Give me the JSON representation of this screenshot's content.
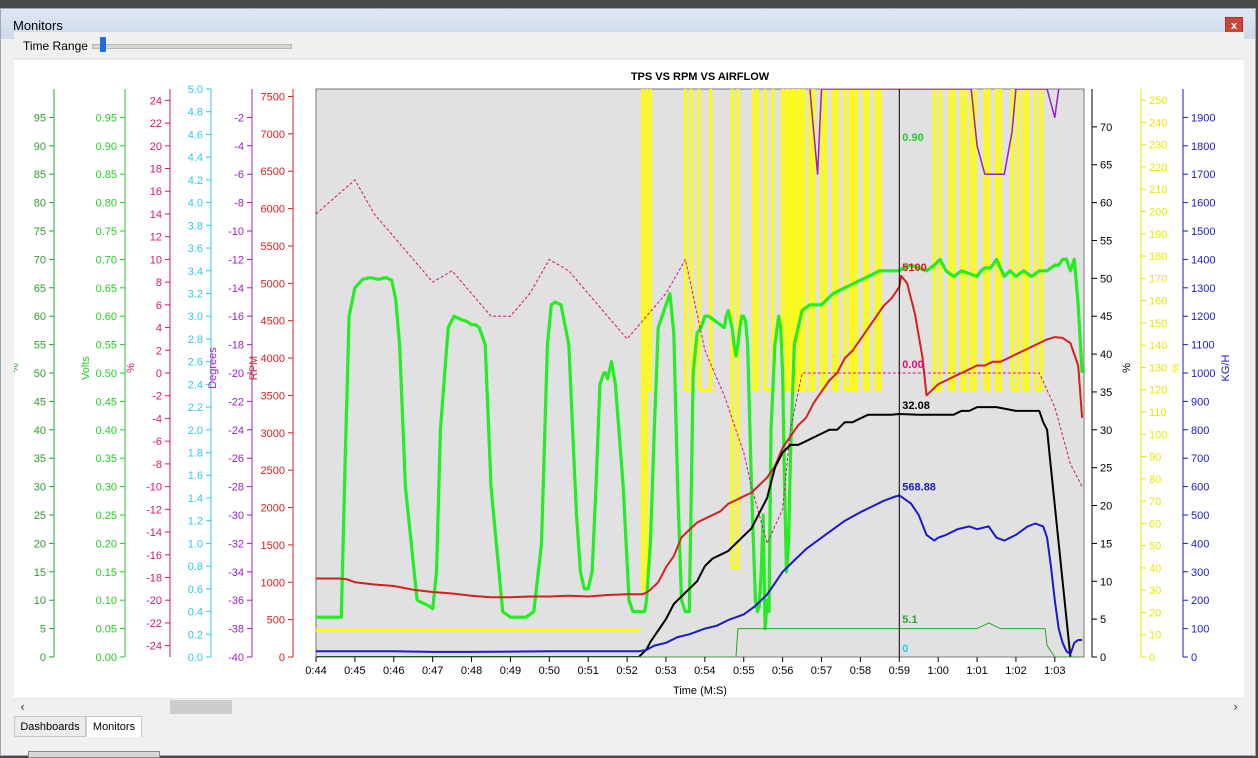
{
  "window": {
    "title": "Monitors",
    "close_label": "x"
  },
  "toolbar": {
    "time_range_label": "Time Range",
    "time_range_position": 0.06
  },
  "tabs": [
    "Dashboards",
    "Monitors"
  ],
  "scroll": {
    "left_arrow": "‹",
    "right_arrow": "›"
  },
  "chart_data": {
    "type": "line",
    "title": "TPS VS RPM VS AIRFLOW",
    "xlabel": "Time (M:S)",
    "x_ticks": [
      "0:44",
      "0:45",
      "0:46",
      "0:47",
      "0:48",
      "0:49",
      "0:50",
      "0:51",
      "0:52",
      "0:53",
      "0:54",
      "0:55",
      "0:56",
      "0:57",
      "0:58",
      "0:59",
      "1:00",
      "1:01",
      "1:02",
      "1:03"
    ],
    "xlim": [
      44,
      63.75
    ],
    "cursor_x": 59,
    "axes": [
      {
        "id": "pct_left",
        "label": "%",
        "color": "#2e9c2e",
        "side": "left",
        "min": 0,
        "max": 100,
        "tick_min": 0,
        "tick_max": 95,
        "step": 5,
        "decimals": 0
      },
      {
        "id": "volts",
        "label": "Volts",
        "color": "#22cc22",
        "side": "left",
        "min": 0,
        "max": 1,
        "tick_min": 0,
        "tick_max": 0.95,
        "step": 0.05,
        "decimals": 2
      },
      {
        "id": "pct_pink",
        "label": "%",
        "color": "#d4147a",
        "side": "left",
        "min": -25,
        "max": 25,
        "tick_min": -24,
        "tick_max": 24,
        "step": 2,
        "decimals": 0
      },
      {
        "id": "fivev",
        "label": "",
        "color": "#2cc8ec",
        "side": "left",
        "min": 0,
        "max": 5,
        "tick_min": 0,
        "tick_max": 5,
        "step": 0.2,
        "decimals": 1
      },
      {
        "id": "degrees",
        "label": "Degrees",
        "color": "#9a1fc8",
        "side": "left",
        "min": -40,
        "max": 0,
        "tick_min": -40,
        "tick_max": -2,
        "step": 2,
        "decimals": 0
      },
      {
        "id": "rpm",
        "label": "RPM",
        "color": "#d42020",
        "side": "left",
        "min": 0,
        "max": 7600,
        "tick_min": 0,
        "tick_max": 7500,
        "step": 500,
        "decimals": 0
      },
      {
        "id": "pct_right",
        "label": "%",
        "color": "#000000",
        "side": "right",
        "min": 0,
        "max": 75,
        "tick_min": 0,
        "tick_max": 70,
        "step": 5,
        "decimals": 0
      },
      {
        "id": "pct_yellow",
        "label": "%",
        "color": "#e8e800",
        "side": "right",
        "min": 0,
        "max": 255,
        "tick_min": 0,
        "tick_max": 250,
        "step": 10,
        "decimals": 0
      },
      {
        "id": "kgh",
        "label": "KG/H",
        "color": "#1a1ac8",
        "side": "right",
        "min": 0,
        "max": 2000,
        "tick_min": 0,
        "tick_max": 1900,
        "step": 100,
        "decimals": 0
      }
    ],
    "series": [
      {
        "axis": "pct_left",
        "color": "#22ee22",
        "width": 3.2,
        "dash": "",
        "x": [
          44,
          44.6,
          44.65,
          44.75,
          44.85,
          45,
          45.2,
          45.4,
          45.6,
          45.8,
          45.95,
          46.05,
          46.15,
          46.3,
          46.6,
          46.9,
          47.0,
          47.1,
          47.2,
          47.4,
          47.55,
          47.7,
          47.9,
          48.0,
          48.1,
          48.2,
          48.35,
          48.5,
          48.8,
          49.0,
          49.2,
          49.4,
          49.6,
          49.8,
          49.95,
          50.05,
          50.15,
          50.3,
          50.5,
          50.6,
          50.7,
          50.8,
          50.9,
          51.0,
          51.1,
          51.2,
          51.3,
          51.4,
          51.45,
          51.5,
          51.6,
          51.7,
          51.9,
          52.05,
          52.15,
          52.25,
          52.35,
          52.4,
          52.45,
          52.5,
          52.6,
          52.7,
          52.8,
          52.9,
          53.0,
          53.1,
          53.2,
          53.3,
          53.4,
          53.5,
          53.6,
          53.7,
          53.8,
          53.9,
          54.0,
          54.1,
          54.3,
          54.5,
          54.55,
          54.6,
          54.7,
          54.75,
          54.8,
          54.85,
          54.9,
          54.95,
          55.0,
          55.05,
          55.1,
          55.2,
          55.3,
          55.35,
          55.4,
          55.45,
          55.5,
          55.55,
          55.6,
          55.65,
          55.7,
          55.8,
          55.9,
          55.95,
          56.0,
          56.05,
          56.1,
          56.15,
          56.2,
          56.3,
          56.5,
          56.7,
          56.8,
          57.0,
          57.3,
          57.6,
          57.9,
          58.2,
          58.5,
          58.8,
          59.0,
          59.1,
          59.3,
          59.5,
          59.7,
          59.9,
          60.05,
          60.2,
          60.4,
          60.6,
          60.8,
          61.0,
          61.1,
          61.2,
          61.35,
          61.5,
          61.7,
          61.85,
          62.0,
          62.2,
          62.4,
          62.6,
          62.8,
          63.0,
          63.1,
          63.2,
          63.3,
          63.4,
          63.5,
          63.6,
          63.7
        ],
        "y": [
          7,
          7,
          7,
          35,
          60,
          65,
          66.5,
          66.8,
          66.5,
          66.8,
          66.3,
          63,
          55,
          30,
          10,
          9,
          8.5,
          15,
          40,
          58,
          60,
          59.5,
          59,
          58.5,
          58.5,
          58,
          55,
          30,
          8,
          7,
          7,
          7,
          8,
          20,
          55,
          62,
          62.5,
          62,
          55,
          40,
          25,
          15,
          12,
          12,
          15,
          30,
          48,
          50,
          50,
          49,
          52,
          48,
          30,
          10,
          8,
          8,
          8,
          8,
          8,
          10,
          20,
          40,
          58,
          60,
          62,
          64,
          57,
          30,
          10,
          8,
          8,
          50,
          57,
          58,
          60,
          60,
          59,
          58,
          60,
          61,
          58,
          55,
          53,
          55,
          58,
          60,
          60,
          59,
          55,
          30,
          10,
          8,
          9,
          15,
          25,
          5,
          10,
          8,
          40,
          55,
          60,
          58,
          50,
          30,
          15,
          20,
          35,
          55,
          61,
          62,
          62,
          62,
          64,
          65,
          66,
          67,
          68,
          68,
          68,
          68.5,
          69,
          68.5,
          68,
          69,
          70,
          68,
          67,
          68,
          67.5,
          67,
          68,
          68.5,
          68.5,
          70,
          67,
          68,
          67,
          68,
          67,
          68,
          68,
          69,
          69,
          70,
          70,
          68,
          70,
          62,
          50
        ]
      },
      {
        "axis": "rpm",
        "color": "#d42020",
        "width": 2,
        "dash": "",
        "x": [
          44,
          44.3,
          44.6,
          44.8,
          45,
          45.5,
          46,
          46.5,
          47,
          47.5,
          48,
          48.5,
          49,
          49.5,
          50,
          50.5,
          51,
          51.5,
          52,
          52.4,
          52.5,
          52.6,
          52.8,
          53,
          53.2,
          53.4,
          53.6,
          53.8,
          54,
          54.2,
          54.4,
          54.6,
          54.8,
          55,
          55.2,
          55.4,
          55.6,
          55.8,
          56,
          56.2,
          56.4,
          56.6,
          56.8,
          57,
          57.2,
          57.4,
          57.6,
          57.8,
          58,
          58.2,
          58.4,
          58.6,
          58.8,
          59,
          59.05,
          59.2,
          59.4,
          59.6,
          59.7,
          59.8,
          60,
          60.2,
          60.4,
          60.6,
          60.8,
          61,
          61.2,
          61.4,
          61.6,
          61.8,
          62,
          62.2,
          62.4,
          62.6,
          62.8,
          63,
          63.2,
          63.4,
          63.6,
          63.7
        ],
        "y": [
          1050,
          1050,
          1050,
          1040,
          1000,
          970,
          950,
          900,
          870,
          850,
          820,
          800,
          800,
          810,
          810,
          820,
          810,
          830,
          840,
          840,
          860,
          900,
          1000,
          1200,
          1350,
          1600,
          1700,
          1800,
          1850,
          1900,
          1950,
          2050,
          2100,
          2150,
          2200,
          2300,
          2400,
          2550,
          2800,
          2950,
          3100,
          3200,
          3400,
          3550,
          3700,
          3800,
          4000,
          4100,
          4250,
          4400,
          4550,
          4700,
          4800,
          4950,
          5100,
          5000,
          4600,
          4000,
          3500,
          3550,
          3650,
          3700,
          3750,
          3800,
          3850,
          3900,
          3900,
          3950,
          3950,
          4000,
          4050,
          4100,
          4150,
          4200,
          4250,
          4280,
          4270,
          4200,
          3900,
          3200
        ]
      },
      {
        "axis": "pct_pink",
        "color": "#d4147a",
        "width": 1,
        "dash": "3,2",
        "x": [
          44,
          44.5,
          45,
          45.5,
          46,
          46.5,
          47,
          47.5,
          48,
          48.5,
          49,
          49.5,
          50,
          50.5,
          51,
          51.5,
          52,
          52.5,
          53,
          53.5,
          54,
          54.5,
          55,
          55.2,
          55.6,
          56,
          56.2,
          56.5,
          57,
          58,
          59,
          60,
          61,
          62,
          62.6,
          63,
          63.4,
          63.7
        ],
        "y": [
          14,
          15.5,
          17,
          14,
          12,
          10,
          8,
          9,
          7,
          5,
          5,
          7,
          10,
          9,
          7,
          5,
          3,
          5,
          7,
          10,
          2,
          -2,
          -7,
          -10,
          -15,
          -12,
          -5,
          0,
          0,
          0,
          0,
          0,
          0,
          0,
          0,
          -3,
          -8,
          -10
        ]
      },
      {
        "axis": "pct_right",
        "color": "#000000",
        "width": 2,
        "dash": "",
        "x": [
          44,
          52.3,
          52.4,
          52.5,
          52.6,
          52.8,
          53,
          53.2,
          53.4,
          53.6,
          53.8,
          54,
          54.2,
          54.4,
          54.6,
          54.8,
          55,
          55.2,
          55.4,
          55.6,
          55.7,
          55.8,
          56,
          56.2,
          56.4,
          56.6,
          56.8,
          57,
          57.2,
          57.4,
          57.6,
          57.8,
          58,
          58.2,
          58.4,
          58.6,
          58.8,
          59,
          59.5,
          60,
          60.2,
          60.4,
          60.6,
          60.8,
          61,
          61.5,
          62,
          62.3,
          62.5,
          62.6,
          62.7,
          62.8,
          62.9,
          63,
          63.2,
          63.4
        ],
        "y": [
          0,
          0,
          0.5,
          1,
          2,
          3.5,
          5,
          7,
          8,
          9,
          10,
          12,
          13,
          13.5,
          14,
          15,
          16,
          17,
          19,
          21,
          23,
          25,
          27,
          28,
          28,
          28.5,
          29,
          29.5,
          30,
          30,
          31,
          31,
          31.5,
          32,
          32,
          32,
          32,
          32.08,
          32,
          32,
          32,
          32,
          32.5,
          32.5,
          33,
          33,
          32.5,
          32.5,
          32.5,
          32.5,
          31,
          30,
          25,
          20,
          10,
          0
        ]
      },
      {
        "axis": "kgh",
        "color": "#1a1ac8",
        "width": 2,
        "dash": "",
        "x": [
          44,
          45,
          46,
          47,
          48,
          49,
          50,
          51,
          52,
          52.3,
          52.5,
          52.7,
          53,
          53.3,
          53.6,
          54,
          54.3,
          54.6,
          55,
          55.3,
          55.6,
          55.8,
          56,
          56.3,
          56.6,
          57,
          57.3,
          57.6,
          58,
          58.3,
          58.6,
          58.9,
          59,
          59.1,
          59.3,
          59.5,
          59.7,
          59.9,
          60,
          60.2,
          60.5,
          60.8,
          61,
          61.3,
          61.5,
          61.7,
          62,
          62.3,
          62.5,
          62.7,
          62.8,
          62.9,
          63,
          63.1,
          63.2,
          63.3,
          63.4,
          63.5,
          63.6,
          63.7
        ],
        "y": [
          20,
          20,
          20,
          18,
          18,
          19,
          20,
          20,
          20,
          20,
          25,
          40,
          50,
          70,
          80,
          100,
          110,
          130,
          150,
          180,
          220,
          260,
          300,
          340,
          380,
          420,
          450,
          480,
          510,
          530,
          550,
          565,
          568.88,
          560,
          540,
          500,
          430,
          410,
          420,
          430,
          450,
          460,
          450,
          460,
          420,
          410,
          430,
          460,
          470,
          460,
          420,
          320,
          200,
          100,
          50,
          20,
          10,
          50,
          60,
          60
        ]
      },
      {
        "axis": "fivev",
        "color": "#22aa22",
        "width": 1,
        "dash": "",
        "x": [
          44,
          54.8,
          54.85,
          59,
          61,
          61.3,
          61.6,
          62,
          62.5,
          62.75,
          62.8,
          63,
          63.7
        ],
        "y": [
          0,
          0,
          0.25,
          0.25,
          0.25,
          0.3,
          0.25,
          0.25,
          0.25,
          0.25,
          0.1,
          0,
          0
        ]
      },
      {
        "axis": "degrees",
        "color": "#9a1fc8",
        "width": 1.5,
        "dash": "",
        "x": [
          56.7,
          56.8,
          56.9,
          57.0,
          60.85,
          61.0,
          61.2,
          61.5,
          61.7,
          61.9,
          62.0,
          62.8,
          62.9,
          63.0,
          63.1
        ],
        "y": [
          0,
          -3,
          -6,
          0,
          0,
          -4,
          -6,
          -6,
          -6,
          -3,
          0,
          0,
          -1,
          -2,
          0
        ]
      }
    ],
    "yellow_trace": {
      "axis": "pct_yellow",
      "color": "#ffff00",
      "base_x": [
        44,
        52.35
      ],
      "base_y": 12,
      "segments": [
        [
          52.4,
          52.5,
          30
        ],
        [
          52.5,
          52.6,
          120
        ],
        [
          53.5,
          53.65,
          120
        ],
        [
          53.85,
          54.15,
          120
        ],
        [
          54.7,
          54.85,
          40
        ],
        [
          55.25,
          55.35,
          120
        ],
        [
          55.55,
          55.75,
          120
        ],
        [
          56.0,
          56.1,
          120
        ],
        [
          56.15,
          56.25,
          120
        ],
        [
          56.3,
          56.4,
          120
        ],
        [
          56.45,
          56.55,
          120
        ],
        [
          56.7,
          56.8,
          120
        ],
        [
          57.0,
          57.1,
          120
        ],
        [
          57.3,
          57.4,
          120
        ],
        [
          57.6,
          57.75,
          120
        ],
        [
          57.8,
          57.9,
          120
        ],
        [
          58.1,
          58.2,
          120
        ],
        [
          58.4,
          58.5,
          120
        ],
        [
          59.9,
          60.05,
          120
        ],
        [
          60.3,
          60.4,
          120
        ],
        [
          60.6,
          60.7,
          120
        ],
        [
          60.85,
          60.95,
          120
        ],
        [
          61.2,
          61.3,
          120
        ],
        [
          61.5,
          61.6,
          120
        ],
        [
          61.9,
          62.05,
          120
        ],
        [
          62.2,
          62.3,
          120
        ],
        [
          62.5,
          62.65,
          120
        ]
      ]
    },
    "annotations": [
      {
        "text": "0.90",
        "color": "#22cc22",
        "axis": "volts",
        "value": 0.9
      },
      {
        "text": "5100",
        "color": "#d42020",
        "axis": "rpm",
        "value": 5100
      },
      {
        "text": "0.00",
        "color": "#d4147a",
        "axis": "pct_pink",
        "value": 0.0
      },
      {
        "text": "32.08",
        "color": "#000000",
        "axis": "pct_right",
        "value": 32.08
      },
      {
        "text": "568.88",
        "color": "#1a1ac8",
        "axis": "kgh",
        "value": 568.88
      },
      {
        "text": "5.1",
        "color": "#22aa22",
        "axis": "pct_left",
        "value": 5.1
      },
      {
        "text": "0",
        "color": "#2cc8ec",
        "axis": "fivev",
        "value": 0
      }
    ]
  }
}
